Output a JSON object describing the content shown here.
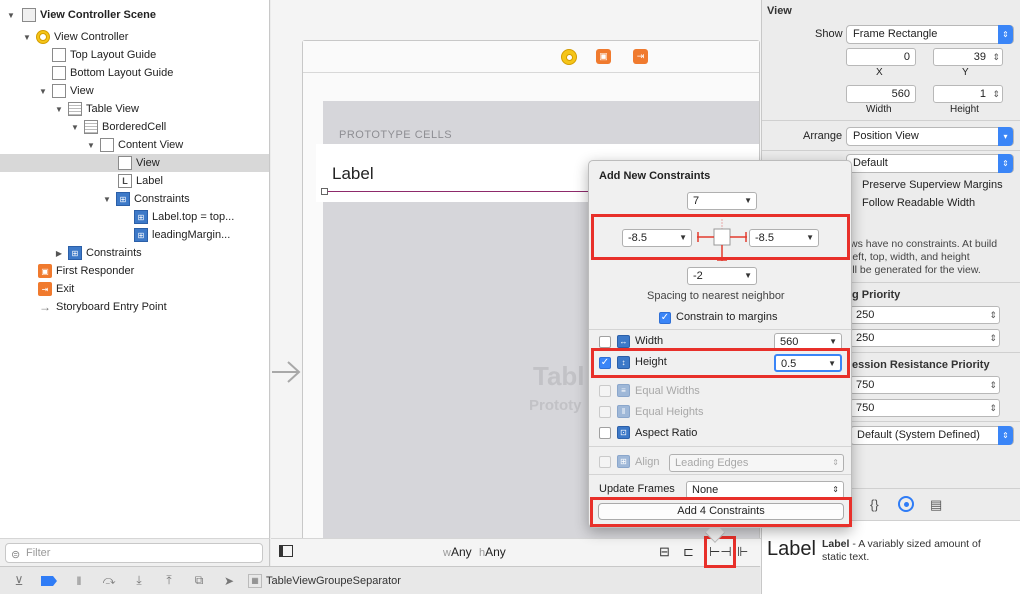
{
  "outline": {
    "rows": [
      {
        "label": "View Controller Scene"
      },
      {
        "label": "View Controller"
      },
      {
        "label": "Top Layout Guide"
      },
      {
        "label": "Bottom Layout Guide"
      },
      {
        "label": "View"
      },
      {
        "label": "Table View"
      },
      {
        "label": "BorderedCell"
      },
      {
        "label": "Content View"
      },
      {
        "label": "View"
      },
      {
        "label": "Label"
      },
      {
        "label": "Constraints"
      },
      {
        "label": "Label.top = top..."
      },
      {
        "label": "leadingMargin..."
      },
      {
        "label": "Constraints"
      },
      {
        "label": "First Responder"
      },
      {
        "label": "Exit"
      },
      {
        "label": "Storyboard Entry Point"
      }
    ],
    "filter_placeholder": "Filter"
  },
  "bottombar": {
    "breadcrumb": "TableViewGroupeSeparator"
  },
  "canvas": {
    "prototype_cells": "PROTOTYPE CELLS",
    "cell_label": "Label",
    "ghost_title": "Tabl",
    "ghost_sub": "Prototy",
    "size_class": {
      "w_prefix": "w",
      "w_value": "Any",
      "h_prefix": "h",
      "h_value": "Any"
    }
  },
  "inspector": {
    "section_view": "View",
    "show_label": "Show",
    "show_value": "Frame Rectangle",
    "x_value": "0",
    "y_value": "39",
    "x_label": "X",
    "y_label": "Y",
    "width_value": "560",
    "height_value": "1",
    "width_label": "Width",
    "height_label": "Height",
    "arrange_label": "Arrange",
    "arrange_value": "Position View",
    "layout_value": "Default",
    "preserve_margins": "Preserve Superview Margins",
    "follow_readable": "Follow Readable Width",
    "no_constraints_text": [
      "ws have no constraints. At build",
      "left, top, width, and height",
      "ill be generated for the view."
    ],
    "hugging_head": "g Priority",
    "hugging_h": "250",
    "hugging_v": "250",
    "compression_head": "ession Resistance Priority",
    "comp_h": "750",
    "comp_v": "750",
    "intrinsic_value": "Default (System Defined)",
    "library_title": "Label",
    "library_name": "Label",
    "library_desc_1": "- A variably sized amount of",
    "library_desc_2": "static text."
  },
  "popup": {
    "title": "Add New Constraints",
    "top_value": "7",
    "left_value": "-8.5",
    "right_value": "-8.5",
    "bottom_value": "-2",
    "spacing_label": "Spacing to nearest neighbor",
    "constrain_margins": "Constrain to margins",
    "width_label": "Width",
    "width_value": "560",
    "height_label": "Height",
    "height_value": "0.5",
    "equal_widths": "Equal Widths",
    "equal_heights": "Equal Heights",
    "aspect_ratio": "Aspect Ratio",
    "align_label": "Align",
    "align_value": "Leading Edges",
    "update_frames_label": "Update Frames",
    "update_frames_value": "None",
    "add_button": "Add 4 Constraints"
  },
  "colors": {
    "accent": "#3a85f7",
    "highlight": "#e8302a",
    "constraint": "#3d79c8"
  }
}
